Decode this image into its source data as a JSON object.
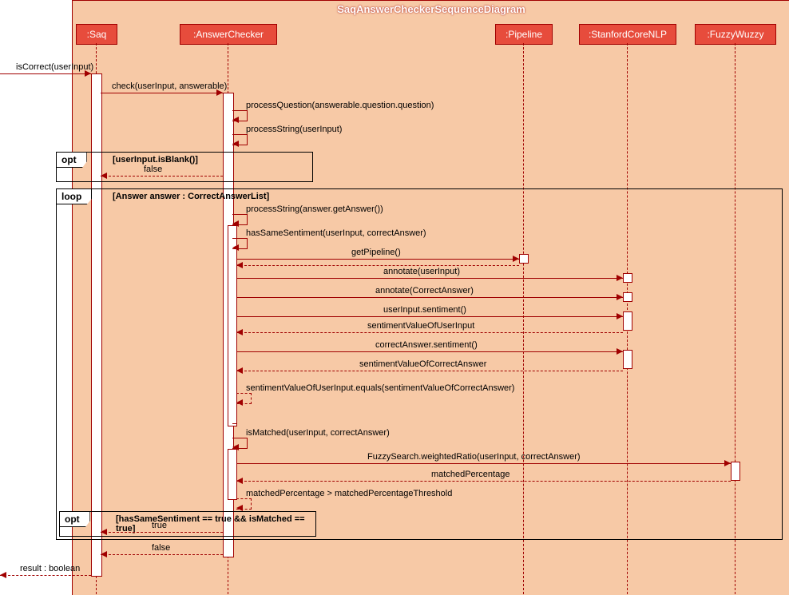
{
  "title": "SaqAnswerCheckerSequenceDiagram",
  "participants": {
    "saq": ":Saq",
    "checker": ":AnswerChecker",
    "pipeline": ":Pipeline",
    "nlp": ":StanfordCoreNLP",
    "fuzzy": ":FuzzyWuzzy"
  },
  "fragments": {
    "opt1_label": "opt",
    "opt1_guard": "[userInput.isBlank()]",
    "loop_label": "loop",
    "loop_guard": "[Answer answer : CorrectAnswerList]",
    "opt2_label": "opt",
    "opt2_guard": "[hasSameSentiment == true && isMatched == true]"
  },
  "messages": {
    "m1": "isCorrect(userInput)",
    "m2": "check(userInput, answerable)",
    "m3": "processQuestion(answerable.question.question)",
    "m4": "processString(userInput)",
    "m5": "false",
    "m6": "processString(answer.getAnswer())",
    "m7": "hasSameSentiment(userInput, correctAnswer)",
    "m8": "getPipeline()",
    "m9": "annotate(userInput)",
    "m10": "annotate(CorrectAnswer)",
    "m11": "userInput.sentiment()",
    "m12": "sentimentValueOfUserInput",
    "m13": "correctAnswer.sentiment()",
    "m14": "sentimentValueOfCorrectAnswer",
    "m15": "sentimentValueOfUserInput.equals(sentimentValueOfCorrectAnswer)",
    "m16": "isMatched(userInput, correctAnswer)",
    "m17": "FuzzySearch.weightedRatio(userInput, correctAnswer)",
    "m18": "matchedPercentage",
    "m19": "matchedPercentage > matchedPercentageThreshold",
    "m20": "true",
    "m21": "false",
    "m22": "result : boolean"
  }
}
